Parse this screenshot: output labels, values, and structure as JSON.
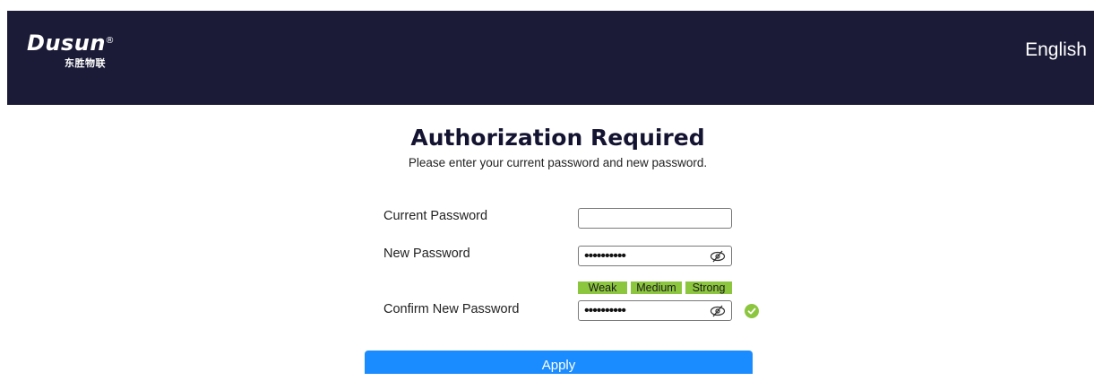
{
  "header": {
    "logo_text": "Dusun",
    "logo_reg": "®",
    "logo_subtext": "东胜物联",
    "language": "English"
  },
  "main": {
    "title": "Authorization Required",
    "subtitle": "Please enter your current password and new password."
  },
  "form": {
    "current_password": {
      "label": "Current Password",
      "value": ""
    },
    "new_password": {
      "label": "New Password",
      "masked_value": "••••••••••"
    },
    "strength_labels": [
      "Weak",
      "Medium",
      "Strong"
    ],
    "confirm_password": {
      "label": "Confirm New Password",
      "masked_value": "••••••••••"
    },
    "apply_label": "Apply"
  },
  "colors": {
    "header_bg": "#1b1b38",
    "strength_green": "#8cc63f",
    "apply_blue": "#1a8cff"
  },
  "icons": {
    "visibility_toggle": "eye-slash-icon",
    "match_indicator": "check-circle-icon"
  }
}
